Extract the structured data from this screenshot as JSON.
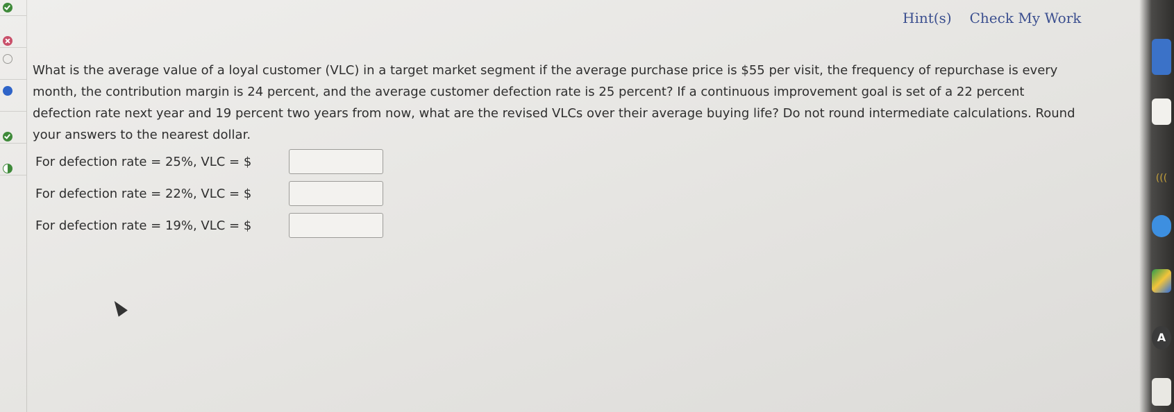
{
  "header": {
    "hints_label": "Hint(s)",
    "check_label": "Check My Work"
  },
  "question": {
    "text": "What is the average value of a loyal customer (VLC) in a target market segment if the average purchase price is $55 per visit, the frequency of repurchase is every month, the contribution margin is 24 percent, and the average customer defection rate is 25 percent? If a continuous improvement goal is set of a 22 percent defection rate next year and 19 percent two years from now, what are the revised VLCs over their average buying life? Do not round intermediate calculations. Round your answers to the nearest dollar."
  },
  "answers": [
    {
      "label": "For defection rate = 25%, VLC = $",
      "value": ""
    },
    {
      "label": "For defection rate = 22%, VLC = $",
      "value": ""
    },
    {
      "label": "For defection rate = 19%, VLC = $",
      "value": ""
    }
  ],
  "rail_status": [
    "check",
    "cross",
    "empty",
    "filled",
    "check",
    "half"
  ],
  "dock": {
    "acrobat_label": "A"
  },
  "colors": {
    "link": "#3b4f8f",
    "check": "#3f8a3a",
    "cross": "#c9506a",
    "current": "#2f64c8"
  }
}
